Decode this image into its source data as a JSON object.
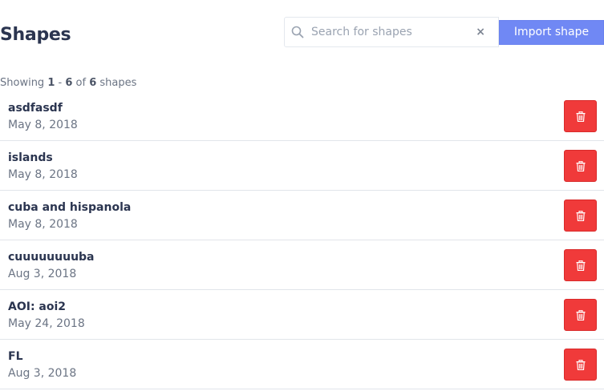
{
  "page": {
    "title": "Shapes"
  },
  "search": {
    "placeholder": "Search for shapes",
    "value": "",
    "clear_label": "×"
  },
  "toolbar": {
    "import_label": "Import shape"
  },
  "summary": {
    "prefix": "Showing",
    "from": "1",
    "sep": "-",
    "to": "6",
    "of": "of",
    "total": "6",
    "suffix": "shapes"
  },
  "shapes": [
    {
      "name": "asdfasdf",
      "date": "May 8, 2018"
    },
    {
      "name": "islands",
      "date": "May 8, 2018"
    },
    {
      "name": "cuba and hispanola",
      "date": "May 8, 2018"
    },
    {
      "name": "cuuuuuuuuba",
      "date": "Aug 3, 2018"
    },
    {
      "name": "AOI: aoi2",
      "date": "May 24, 2018"
    },
    {
      "name": "FL",
      "date": "Aug 3, 2018"
    }
  ],
  "icons": {
    "search": "search-icon",
    "clear": "close-icon",
    "delete": "trash-icon"
  },
  "colors": {
    "accent": "#7088f4",
    "danger": "#f03a3a",
    "title": "#2b3550",
    "muted": "#6b7484"
  }
}
